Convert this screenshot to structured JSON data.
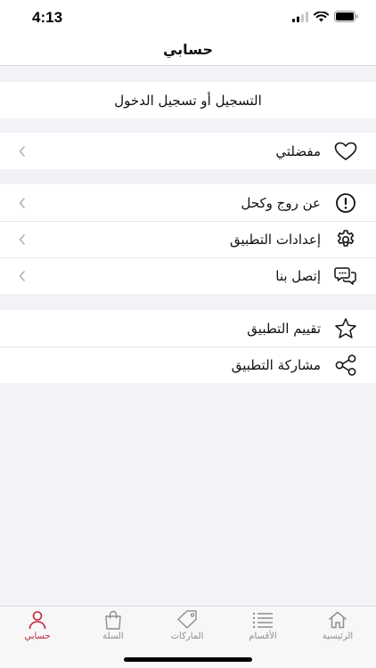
{
  "status_bar": {
    "time": "4:13"
  },
  "nav": {
    "title": "حسابي"
  },
  "login": {
    "label": "التسجيل أو تسجيل الدخول"
  },
  "group1": {
    "items": [
      {
        "label": "مفضلتي",
        "icon": "heart-icon"
      }
    ]
  },
  "group2": {
    "items": [
      {
        "label": "عن روج وكحل",
        "icon": "info-icon"
      },
      {
        "label": "إعدادات التطبيق",
        "icon": "gear-icon"
      },
      {
        "label": "إتصل بنا",
        "icon": "chat-bubbles-icon"
      }
    ]
  },
  "group3": {
    "items": [
      {
        "label": "تقييم التطبيق",
        "icon": "star-icon"
      },
      {
        "label": "مشاركة التطبيق",
        "icon": "share-icon"
      }
    ]
  },
  "tabs": [
    {
      "label": "الرئيسية",
      "icon": "home-icon"
    },
    {
      "label": "الأقسام",
      "icon": "list-icon"
    },
    {
      "label": "الماركات",
      "icon": "tag-icon"
    },
    {
      "label": "السلة",
      "icon": "bag-icon"
    },
    {
      "label": "حسابي",
      "icon": "person-icon",
      "active": true
    }
  ],
  "colors": {
    "accent": "#c3233a",
    "background": "#f2f2f7",
    "tab_inactive": "#8e8e93"
  }
}
